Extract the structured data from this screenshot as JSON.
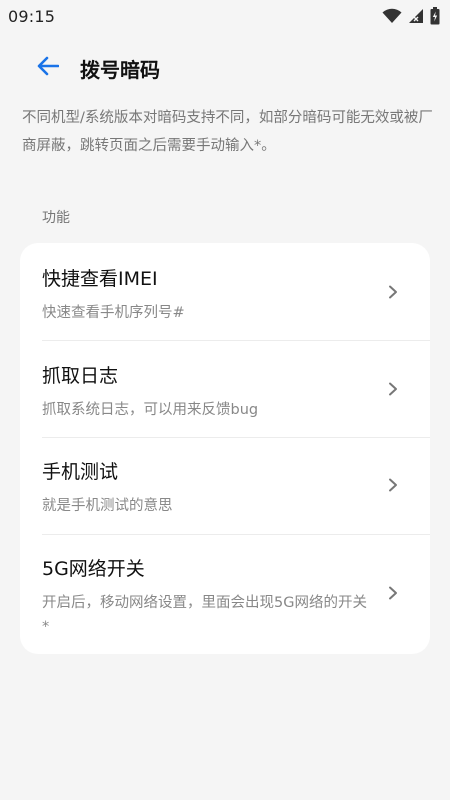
{
  "status_bar": {
    "time": "09:15",
    "icons": [
      "wifi-icon",
      "signal-icon",
      "battery-charging-icon"
    ]
  },
  "header": {
    "back_icon": "arrow-left-icon",
    "title": "拨号暗码"
  },
  "notice": "不同机型/系统版本对暗码支持不同，如部分暗码可能无效或被厂商屏蔽，跳转页面之后需要手动输入*。",
  "section": {
    "label": "功能",
    "items": [
      {
        "title": "快捷查看IMEI",
        "desc": "快速查看手机序列号#"
      },
      {
        "title": "抓取日志",
        "desc": "抓取系统日志，可以用来反馈bug"
      },
      {
        "title": "手机测试",
        "desc": "就是手机测试的意思"
      },
      {
        "title": "5G网络开关",
        "desc": "开启后，移动网络设置，里面会出现5G网络的开关*"
      }
    ]
  },
  "colors": {
    "accent": "#1a73e8",
    "background": "#f5f5f5",
    "card": "#ffffff"
  }
}
